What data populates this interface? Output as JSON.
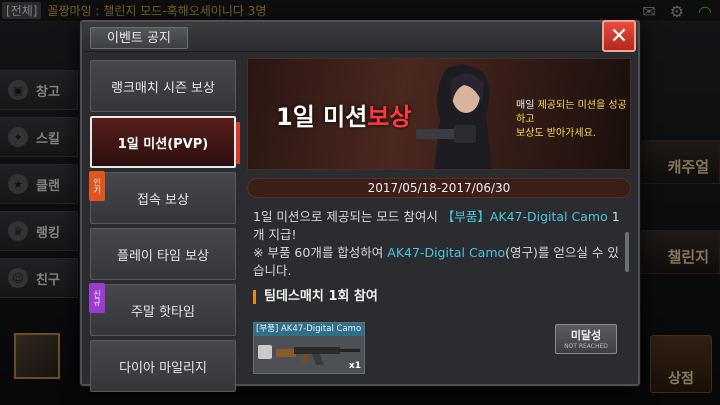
{
  "chat": {
    "tag": "[전체]",
    "message": "꼴짱마잉 : 챌린지 모드-혹해오세이니다 3명"
  },
  "left_menu": [
    "창고",
    "스킬",
    "클랜",
    "랭킹",
    "친구"
  ],
  "right_menu": {
    "season": "캐주얼",
    "challenge": "챌린지",
    "shop": "상점"
  },
  "modal": {
    "title": "이벤트 공지",
    "close_label": "✕",
    "tabs": [
      {
        "label": "랭크매치 시즌 보상",
        "active": false,
        "badge": ""
      },
      {
        "label": "1일 미션(PVP)",
        "active": true,
        "badge": ""
      },
      {
        "label": "접속 보상",
        "active": false,
        "badge": "인기"
      },
      {
        "label": "플레이 타임 보상",
        "active": false,
        "badge": ""
      },
      {
        "label": "주말 핫타임",
        "active": false,
        "badge": "신규"
      },
      {
        "label": "다이아 마일리지",
        "active": false,
        "badge": ""
      }
    ],
    "banner": {
      "title_white": "1일 미션",
      "title_red": "보상",
      "subtitle_line1": "매일 ",
      "subtitle_highlight": "제공되는 미션을 성공하고",
      "subtitle_line2": "보상도 받아가세요."
    },
    "date_range": "2017/05/18-2017/06/30",
    "description": {
      "part1": "1일 미션으로 제공되는 모드 참여시 ",
      "item1": "【부품】AK47-Digital Camo",
      "part2": " 1개 지급!",
      "part3": "※ 부품 60개를 합성하여 ",
      "item2": "AK47-Digital Camo",
      "part4": "(영구)를 얻으실 수 있습니다."
    },
    "mission": "팀데스매치 1회 참여",
    "reward": {
      "name": "[부품] AK47-Digital Camo",
      "quantity": "x1"
    },
    "status": {
      "label": "미달성",
      "sub": "NOT REACHED"
    }
  }
}
